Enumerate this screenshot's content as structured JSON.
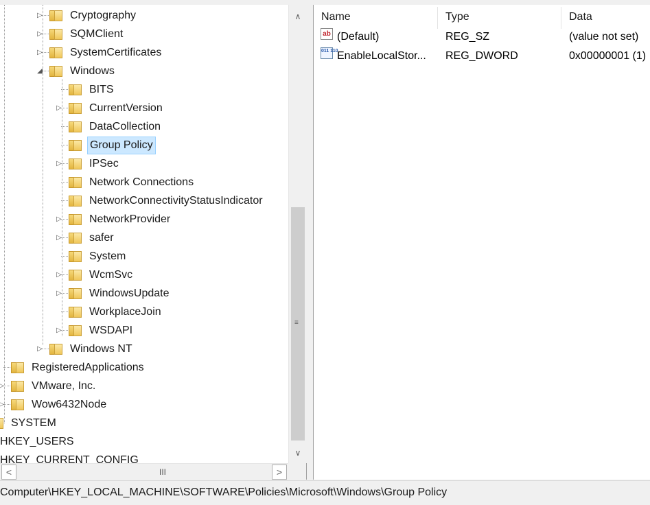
{
  "tree": {
    "items": [
      {
        "label": "Cryptography",
        "expander": "▷"
      },
      {
        "label": "SQMClient",
        "expander": "▷"
      },
      {
        "label": "SystemCertificates",
        "expander": "▷"
      },
      {
        "label": "Windows",
        "expander": "◢"
      },
      {
        "label": "BITS",
        "expander": ""
      },
      {
        "label": "CurrentVersion",
        "expander": "▷"
      },
      {
        "label": "DataCollection",
        "expander": ""
      },
      {
        "label": "Group Policy",
        "expander": ""
      },
      {
        "label": "IPSec",
        "expander": "▷"
      },
      {
        "label": "Network Connections",
        "expander": ""
      },
      {
        "label": "NetworkConnectivityStatusIndicator",
        "expander": ""
      },
      {
        "label": "NetworkProvider",
        "expander": "▷"
      },
      {
        "label": "safer",
        "expander": "▷"
      },
      {
        "label": "System",
        "expander": ""
      },
      {
        "label": "WcmSvc",
        "expander": "▷"
      },
      {
        "label": "WindowsUpdate",
        "expander": "▷"
      },
      {
        "label": "WorkplaceJoin",
        "expander": ""
      },
      {
        "label": "WSDAPI",
        "expander": "▷"
      },
      {
        "label": "Windows NT",
        "expander": "▷"
      },
      {
        "label": "RegisteredApplications",
        "expander": ""
      },
      {
        "label": "VMware, Inc.",
        "expander": "▷"
      },
      {
        "label": "Wow6432Node",
        "expander": "▷"
      },
      {
        "label": "SYSTEM",
        "expander": ""
      },
      {
        "label": "HKEY_USERS",
        "expander": ""
      },
      {
        "label": "HKEY_CURRENT_CONFIG",
        "expander": ""
      }
    ],
    "selected": "Group Policy"
  },
  "scrollbar": {
    "up": "∧",
    "down": "∨",
    "left": "<",
    "right": ">",
    "grip_v": "≡",
    "grip_h": "III"
  },
  "values": {
    "columns": [
      "Name",
      "Type",
      "Data"
    ],
    "rows": [
      {
        "icon": "string-value-icon",
        "icon_text": "ab",
        "name": "(Default)",
        "type": "REG_SZ",
        "data": "(value not set)"
      },
      {
        "icon": "binary-value-icon",
        "icon_text": "011 110",
        "name": "EnableLocalStor...",
        "type": "REG_DWORD",
        "data": "0x00000001 (1)"
      }
    ]
  },
  "status": {
    "path": "Computer\\HKEY_LOCAL_MACHINE\\SOFTWARE\\Policies\\Microsoft\\Windows\\Group Policy"
  },
  "colors": {
    "selection_bg": "#cce8ff",
    "selection_border": "#99d1ff",
    "folder": "#f0c75a"
  }
}
